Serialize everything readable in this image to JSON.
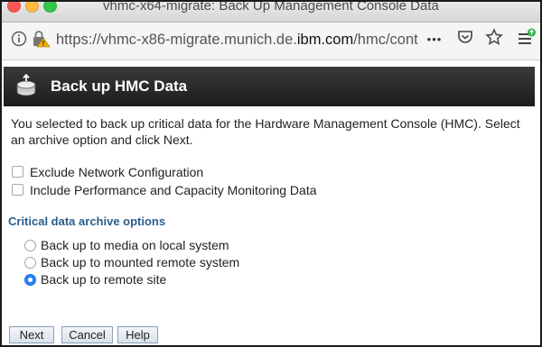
{
  "window": {
    "title": "vhmc-x64-migrate: Back Up Management Console Data"
  },
  "urlbar": {
    "url_prefix": "https://vhmc-x86-migrate.munich.de.",
    "url_domain": "ibm.com",
    "url_suffix": "/hmc/cont",
    "more_label": "•••"
  },
  "page": {
    "title": "Back up HMC Data",
    "intro": "You selected to back up critical data for the Hardware Management Console (HMC). Select an archive option and click Next.",
    "checkboxes": [
      {
        "label": "Exclude Network Configuration",
        "checked": false
      },
      {
        "label": "Include Performance and Capacity Monitoring Data",
        "checked": false
      }
    ],
    "section_title": "Critical data archive options",
    "options": [
      {
        "label": "Back up to media on local system",
        "selected": false
      },
      {
        "label": "Back up to mounted remote system",
        "selected": false
      },
      {
        "label": "Back up to remote site",
        "selected": true
      }
    ],
    "buttons": {
      "next": "Next",
      "cancel": "Cancel",
      "help": "Help"
    }
  }
}
